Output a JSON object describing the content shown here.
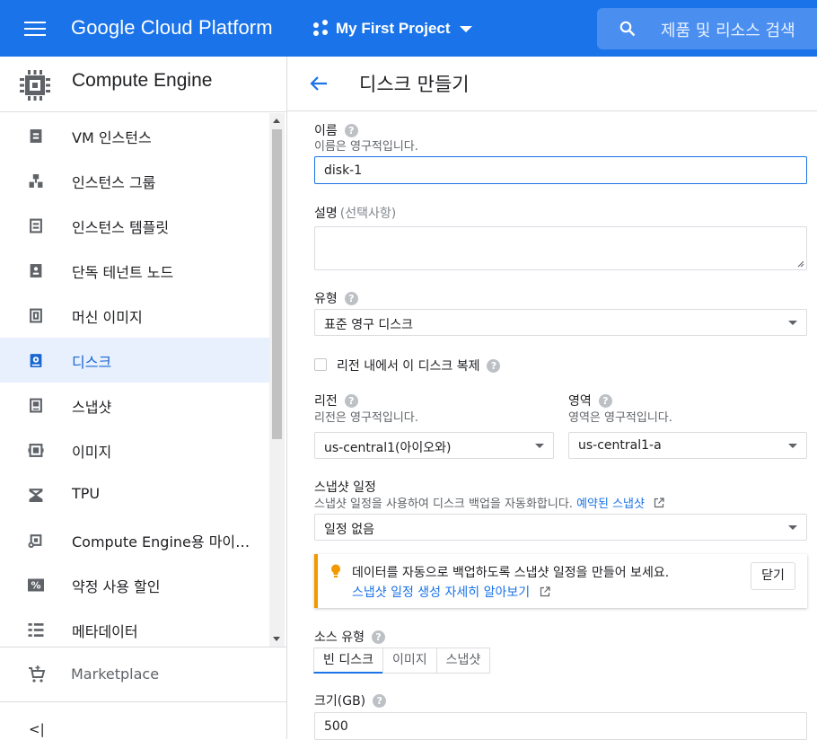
{
  "topbar": {
    "product_name": "Google Cloud Platform",
    "project_name": "My First Project",
    "search_placeholder": "제품 및 리소스 검색",
    "brand_color": "#1a73e8"
  },
  "sidebar": {
    "title": "Compute Engine",
    "items": [
      {
        "label": "VM 인스턴스",
        "icon": "vm-instance-icon",
        "active": false
      },
      {
        "label": "인스턴스 그룹",
        "icon": "instance-group-icon",
        "active": false
      },
      {
        "label": "인스턴스 템플릿",
        "icon": "instance-template-icon",
        "active": false
      },
      {
        "label": "단독 테넌트 노드",
        "icon": "sole-tenant-icon",
        "active": false
      },
      {
        "label": "머신 이미지",
        "icon": "machine-image-icon",
        "active": false
      },
      {
        "label": "디스크",
        "icon": "disk-icon",
        "active": true
      },
      {
        "label": "스냅샷",
        "icon": "snapshot-icon",
        "active": false
      },
      {
        "label": "이미지",
        "icon": "image-icon",
        "active": false
      },
      {
        "label": "TPU",
        "icon": "tpu-icon",
        "active": false
      },
      {
        "label": "Compute Engine용 마이…",
        "icon": "migrate-icon",
        "active": false
      },
      {
        "label": "약정 사용 할인",
        "icon": "percent-icon",
        "active": false
      },
      {
        "label": "메타데이터",
        "icon": "metadata-icon",
        "active": false
      }
    ],
    "marketplace_label": "Marketplace",
    "collapse_label": "<|"
  },
  "main": {
    "page_title": "디스크 만들기",
    "name": {
      "label": "이름",
      "hint": "이름은 영구적입니다.",
      "value": "disk-1"
    },
    "description": {
      "label": "설명",
      "optional": "(선택사항)"
    },
    "type": {
      "label": "유형",
      "value": "표준 영구 디스크"
    },
    "replicate": {
      "label": "리전 내에서 이 디스크 복제",
      "checked": false
    },
    "region": {
      "label": "리전",
      "hint": "리전은 영구적입니다.",
      "value": "us-central1(아이오와)"
    },
    "zone": {
      "label": "영역",
      "hint": "영역은 영구적입니다.",
      "value": "us-central1-a"
    },
    "snapshot_schedule": {
      "label": "스냅샷 일정",
      "hint": "스냅샷 일정을 사용하여 디스크 백업을 자동화합니다.",
      "hint_link": "예약된 스냅샷",
      "value": "일정 없음"
    },
    "callout": {
      "text": "데이터를 자동으로 백업하도록 스냅샷 일정을 만들어 보세요.",
      "link": "스냅샷 일정 생성 자세히 알아보기",
      "dismiss": "닫기"
    },
    "source_type": {
      "label": "소스 유형",
      "options": [
        "빈 디스크",
        "이미지",
        "스냅샷"
      ],
      "selected": "빈 디스크"
    },
    "size": {
      "label": "크기(GB)",
      "value": "500"
    }
  }
}
